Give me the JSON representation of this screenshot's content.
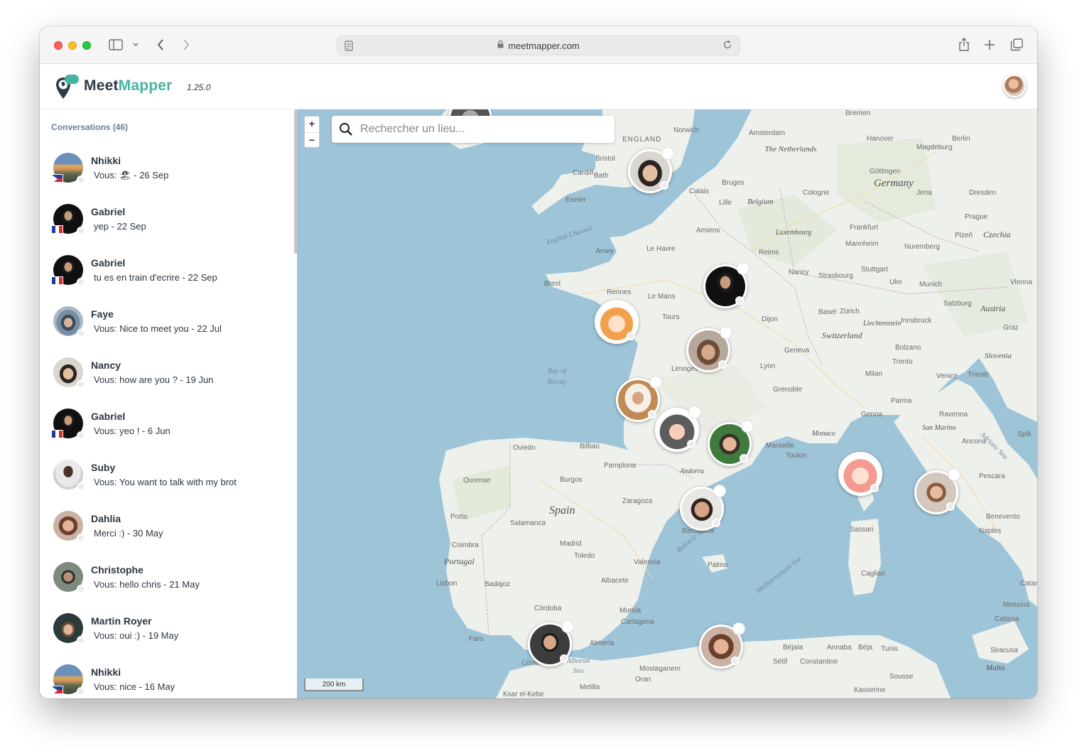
{
  "browser": {
    "url": "meetmapper.com"
  },
  "app": {
    "brand_part1": "Meet",
    "brand_part2": "Mapper",
    "version": "1.25.0"
  },
  "sidebar": {
    "title": "Conversations (46)",
    "conversations": [
      {
        "name": "Nhikki",
        "message": "Vous: 🏖 - 26 Sep",
        "flag": "ph"
      },
      {
        "name": "Gabriel",
        "message": "yep - 22 Sep",
        "flag": "fr"
      },
      {
        "name": "Gabriel",
        "message": "tu es en train d'ecrire - 22 Sep",
        "flag": "fr"
      },
      {
        "name": "Faye",
        "message": "Vous: Nice to meet you - 22 Jul",
        "flag": ""
      },
      {
        "name": "Nancy",
        "message": "Vous: how are you ? - 19 Jun",
        "flag": ""
      },
      {
        "name": "Gabriel",
        "message": "Vous: yeo ! - 6 Jun",
        "flag": "fr"
      },
      {
        "name": "Suby",
        "message": "Vous: You want to talk with my brot",
        "flag": ""
      },
      {
        "name": "Dahlia",
        "message": "Merci :) - 30 May",
        "flag": ""
      },
      {
        "name": "Christophe",
        "message": "Vous: hello chris - 21 May",
        "flag": ""
      },
      {
        "name": "Martin Royer",
        "message": "Vous: oui :) - 19 May",
        "flag": ""
      },
      {
        "name": "Nhikki",
        "message": "Vous: nice - 16 May",
        "flag": "ph"
      }
    ]
  },
  "map": {
    "zoom_in": "+",
    "zoom_out": "−",
    "search_placeholder": "Rechercher un lieu...",
    "scale": "200 km",
    "labels": {
      "england": "ENGLAND",
      "germany": "Germany",
      "netherlands": "The Netherlands",
      "belgium": "Belgium",
      "luxembourg": "Luxembourg",
      "czechia": "Czechia",
      "austria": "Austria",
      "switzerland": "Switzerland",
      "liechtenstein": "Liechtenstein",
      "slovenia": "Slovenia",
      "spain": "Spain",
      "portugal": "Portugal",
      "andorra": "Andorra",
      "monaco": "Monaco",
      "san_marino": "San Marino",
      "malta": "Malta",
      "english_channel": "English Channel",
      "bay_of_biscay": "Bay of Biscay",
      "balearic_sea": "Balearic Sea",
      "mediterranean_sea": "Mediterranean Sea",
      "adriatic_sea": "Adriatic Sea",
      "alboran_sea": "Alboran Sea",
      "jersey": "Jersey",
      "bremen": "Bremen",
      "berlin": "Berlin",
      "amsterdam": "Amsterdam",
      "bristol": "Bristol",
      "cardiff": "Cardiff",
      "bath": "Bath",
      "exeter": "Exeter",
      "norwich": "Norwich",
      "hanover": "Hanover",
      "magdeburg": "Magdeburg",
      "gottingen": "Göttingen",
      "cologne": "Cologne",
      "jena": "Jena",
      "dresden": "Dresden",
      "frankfurt": "Frankfurt",
      "prague": "Prague",
      "plzen": "Plzeň",
      "mannheim": "Mannheim",
      "nuremberg": "Nuremberg",
      "stuttgart": "Stuttgart",
      "munich": "Munich",
      "ulm": "Ulm",
      "strasbourg": "Strasbourg",
      "nancy": "Nancy",
      "reims": "Reims",
      "amiens": "Amiens",
      "lille": "Lille",
      "calais": "Calais",
      "bruges": "Bruges",
      "le_havre": "Le Havre",
      "brest": "Brest",
      "rennes": "Rennes",
      "le_mans": "Le Mans",
      "tours": "Tours",
      "dijon": "Dijon",
      "basel": "Basel",
      "zurich": "Zürich",
      "salzburg": "Salzburg",
      "vienna": "Vienna",
      "graz": "Graz",
      "innsbruck": "Innsbruck",
      "bolzano": "Bolzano",
      "trento": "Trento",
      "geneva": "Geneva",
      "lyon": "Lyon",
      "limoges": "Limoges",
      "grenoble": "Grenoble",
      "milan": "Milan",
      "venice": "Venice",
      "trieste": "Trieste",
      "parma": "Parma",
      "ravenna": "Ravenna",
      "genoa": "Genoa",
      "marseille": "Marseille",
      "toulon": "Toulon",
      "bilbao": "Bilbao",
      "oviedo": "Oviedo",
      "pamplona": "Pamplona",
      "burgos": "Burgos",
      "zaragoza": "Zaragoza",
      "barcelona": "Barcelona",
      "ourense": "Ourense",
      "porto": "Porto",
      "salamanca": "Salamanca",
      "madrid": "Madrid",
      "toledo": "Toledo",
      "coimbra": "Coimbra",
      "lisbon": "Lisbon",
      "badajoz": "Badajoz",
      "valencia": "Valencia",
      "albacete": "Albacete",
      "palma": "Palma",
      "murcia": "Murcia",
      "cordoba": "Córdoba",
      "faro": "Faro",
      "cartagena": "Cartagena",
      "almeria": "Almería",
      "gibraltar": "Gibraltar",
      "mostaganem": "Mostaganem",
      "oran": "Oran",
      "melilla": "Melilla",
      "setif": "Sétif",
      "constantine": "Constantine",
      "bejaia": "Béjaïa",
      "annaba": "Annaba",
      "beja": "Béja",
      "tunis": "Tunis",
      "sousse": "Sousse",
      "kasserine": "Kasserine",
      "ksar_el_kebir": "Ksar el-Kebir",
      "sassari": "Sassari",
      "cagliari": "Cagliari",
      "pescara": "Pescara",
      "ancona": "Ancona",
      "split": "Split",
      "benevento": "Benevento",
      "naples": "Naples",
      "messina": "Messina",
      "catania": "Catania",
      "siracusa": "Siracusa",
      "catanzaro": "Catanzaro"
    }
  },
  "colors": {
    "accent": "#45b3a3",
    "sea": "#9ec4d8",
    "land": "#eef0ec",
    "status_offline": "#ececec"
  }
}
